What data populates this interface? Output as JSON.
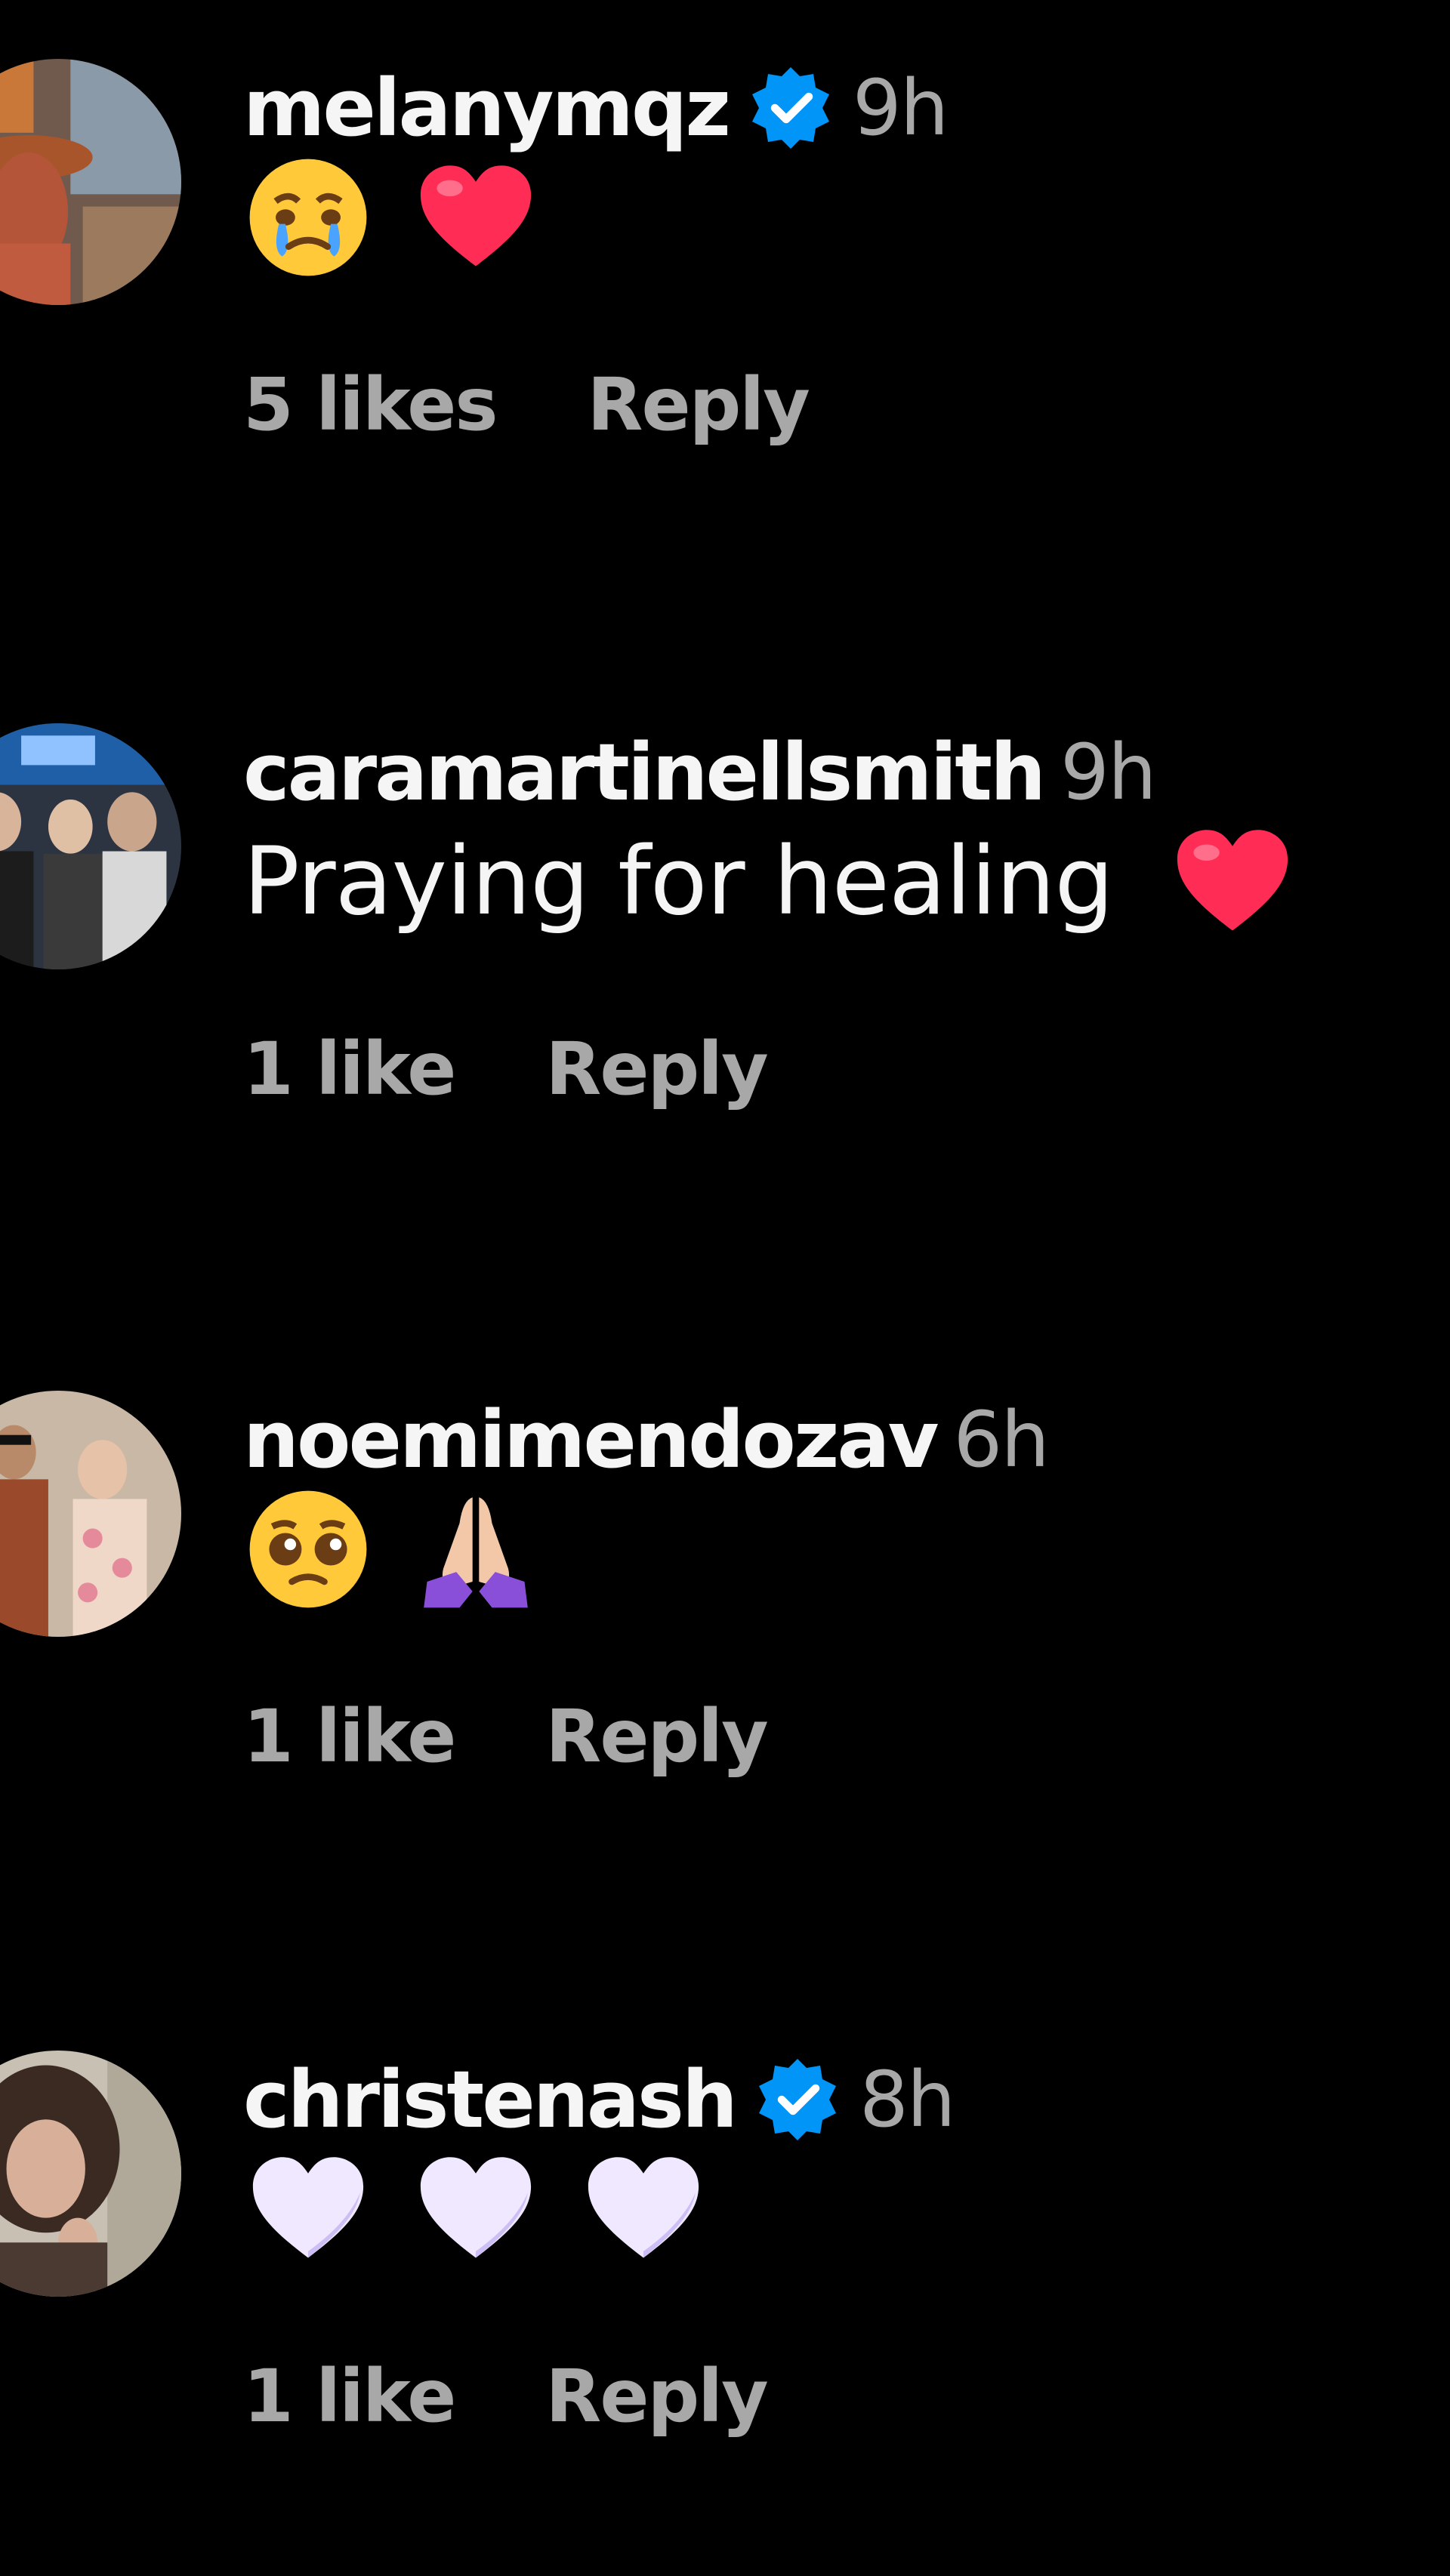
{
  "comments": [
    {
      "username": "melanymqz",
      "verified": true,
      "time": "9h",
      "text": "",
      "emojis": [
        "crying-face",
        "red-heart"
      ],
      "likes": "5 likes",
      "reply": "Reply"
    },
    {
      "username": "caramartinellsmith",
      "verified": false,
      "time": "9h",
      "text": "Praying for healing",
      "emojis": [
        "red-heart"
      ],
      "likes": "1 like",
      "reply": "Reply"
    },
    {
      "username": "noemimendozav",
      "verified": false,
      "time": "6h",
      "text": "",
      "emojis": [
        "pleading-face",
        "folded-hands"
      ],
      "likes": "1 like",
      "reply": "Reply"
    },
    {
      "username": "christenash",
      "verified": true,
      "time": "8h",
      "text": "",
      "emojis": [
        "white-heart",
        "white-heart",
        "white-heart"
      ],
      "likes": "1 like",
      "reply": "Reply"
    }
  ],
  "colors": {
    "background": "#000000",
    "primary_text": "#f5f5f5",
    "secondary_text": "#a8a8a8",
    "verified_blue": "#0095f6",
    "heart_red": "#ff2d55"
  }
}
